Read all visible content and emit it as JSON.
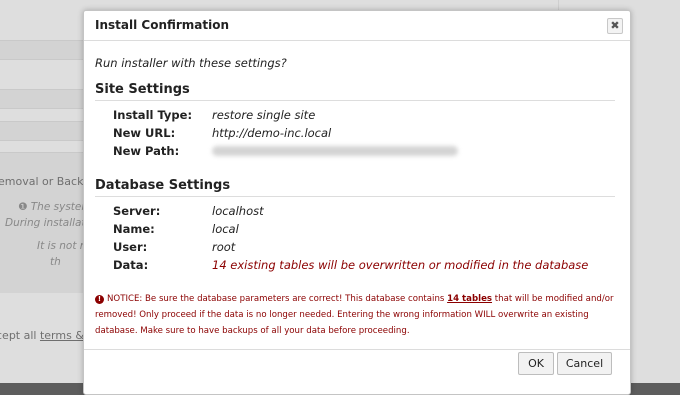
{
  "background": {
    "line1": "emoval or Backup",
    "line2": "The system",
    "line3": "During installatio",
    "line4": "It is not r",
    "line5": "th",
    "line6_prefix": "cept all ",
    "line6_link": "terms & c"
  },
  "dialog": {
    "title": "Install Confirmation",
    "close_glyph": "✖",
    "intro": "Run installer with these settings?",
    "site_settings": {
      "heading": "Site Settings",
      "rows": [
        {
          "label": "Install Type:",
          "value": "restore single site"
        },
        {
          "label": "New URL:",
          "value": "http://demo-inc.local"
        },
        {
          "label": "New Path:",
          "value": ""
        }
      ]
    },
    "database_settings": {
      "heading": "Database Settings",
      "rows": [
        {
          "label": "Server:",
          "value": "localhost"
        },
        {
          "label": "Name:",
          "value": "local"
        },
        {
          "label": "User:",
          "value": "root"
        },
        {
          "label": "Data:",
          "value": "14 existing tables will be overwritten or modified in the database"
        }
      ]
    },
    "notice": {
      "icon": "info-icon",
      "part1": "NOTICE: Be sure the database parameters are correct! This database contains ",
      "count": "14 tables",
      "part2": " that will be modified and/or removed! Only proceed if the data is no longer needed. Entering the wrong information WILL overwrite an existing database. Make sure to have backups of all your data before proceeding."
    },
    "buttons": {
      "ok": "OK",
      "cancel": "Cancel"
    }
  },
  "colors": {
    "warning": "#8b0000",
    "overlay": "#5d5d5d"
  }
}
